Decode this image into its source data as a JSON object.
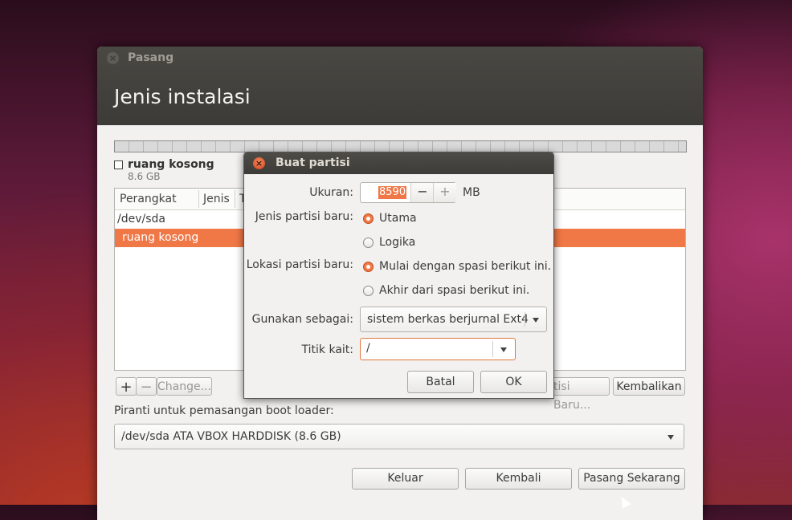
{
  "window": {
    "title": "Pasang",
    "header": "Jenis instalasi"
  },
  "partition_legend": {
    "name": "ruang kosong",
    "size": "8.6 GB"
  },
  "table": {
    "columns": [
      "Perangkat",
      "Jenis",
      "T"
    ],
    "rows": [
      {
        "device": "/dev/sda",
        "selected": false
      },
      {
        "device": "ruang kosong",
        "selected": true
      }
    ]
  },
  "table_buttons": {
    "add": "+",
    "remove": "−",
    "change": "Change...",
    "new_table": "tisi Baru...",
    "revert": "Kembalikan"
  },
  "bootloader": {
    "label": "Piranti untuk pemasangan boot loader:",
    "value": "/dev/sda  ATA VBOX HARDDISK (8.6 GB)"
  },
  "footer": {
    "quit": "Keluar",
    "back": "Kembali",
    "install": "Pasang Sekarang"
  },
  "dialog": {
    "title": "Buat partisi",
    "size_label": "Ukuran:",
    "size_value": "8590",
    "size_unit": "MB",
    "type_label": "Jenis partisi baru:",
    "type_primary": "Utama",
    "type_logical": "Logika",
    "type_selected": "Utama",
    "location_label": "Lokasi partisi baru:",
    "location_begin": "Mulai dengan spasi berikut ini.",
    "location_end": "Akhir dari spasi berikut ini.",
    "location_selected": "Mulai dengan spasi berikut ini.",
    "use_as_label": "Gunakan sebagai:",
    "use_as_value": "sistem berkas berjurnal Ext4",
    "mount_label": "Titik kait:",
    "mount_value": "/",
    "cancel": "Batal",
    "ok": "OK"
  },
  "colors": {
    "accent": "#f07746",
    "titlebar": "#3c3b37",
    "window_bg": "#f2f1f0"
  }
}
